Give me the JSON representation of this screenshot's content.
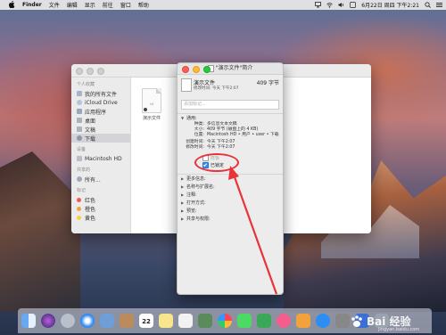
{
  "menubar": {
    "app": "Finder",
    "items": [
      "文件",
      "编辑",
      "显示",
      "前往",
      "窗口",
      "帮助"
    ],
    "clock": "6月22日 周四 下午2:21"
  },
  "finder": {
    "sidebar": {
      "favorites_header": "个人收藏",
      "favorites": [
        "我的所有文件",
        "iCloud Drive",
        "应用程序",
        "桌面",
        "文稿",
        "下载"
      ],
      "devices_header": "设备",
      "devices": [
        "Macintosh HD"
      ],
      "shared_header": "共享的",
      "shared": [
        "所有..."
      ],
      "tags_header": "标记",
      "tags": [
        {
          "label": "红色",
          "color": "#f25a52"
        },
        {
          "label": "橙色",
          "color": "#f4a33c"
        },
        {
          "label": "黄色",
          "color": "#f5d33b"
        }
      ]
    },
    "file": {
      "name": "演示文件",
      "ext": "rtf"
    }
  },
  "info": {
    "title": "\"演示文件\"简介",
    "name": "演示文件",
    "size": "409 字节",
    "modified": "修改时间: 今天 下午2:07",
    "tags_placeholder": "添加标记...",
    "general": {
      "header": "通用:",
      "rows": [
        {
          "k": "种类:",
          "v": "多信息文本文稿"
        },
        {
          "k": "大小:",
          "v": "409 字节 (磁盘上的 4 KB)"
        },
        {
          "k": "位置:",
          "v": "Macintosh HD • 用户 • user • 下载"
        },
        {
          "k": "创建时间:",
          "v": "今天 下午2:07"
        },
        {
          "k": "修改时间:",
          "v": "今天 下午2:07"
        }
      ],
      "template_label": "样板",
      "locked_label": "已锁定"
    },
    "sections": [
      "更多信息:",
      "名称与扩展名:",
      "注释:",
      "打开方式:",
      "预览:",
      "共享与权限:"
    ]
  },
  "watermark": {
    "text": "Bai 经验",
    "url": "jingyan.baidu.com"
  },
  "colors": {
    "annotation": "#e8333a",
    "checkbox_checked": "#3d8cf0"
  }
}
